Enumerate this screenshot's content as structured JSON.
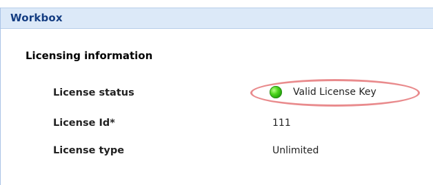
{
  "panel": {
    "title": "Workbox"
  },
  "section": {
    "title": "Licensing information"
  },
  "rows": [
    {
      "label": "License status",
      "value": "Valid License Key",
      "status_color": "#2fc41a"
    },
    {
      "label": "License Id*",
      "value": "111"
    },
    {
      "label": "License type",
      "value": "Unlimited"
    }
  ],
  "colors": {
    "header_bg": "#dce9f8",
    "header_text": "#143d82",
    "highlight_ellipse": "#e98b8d"
  }
}
